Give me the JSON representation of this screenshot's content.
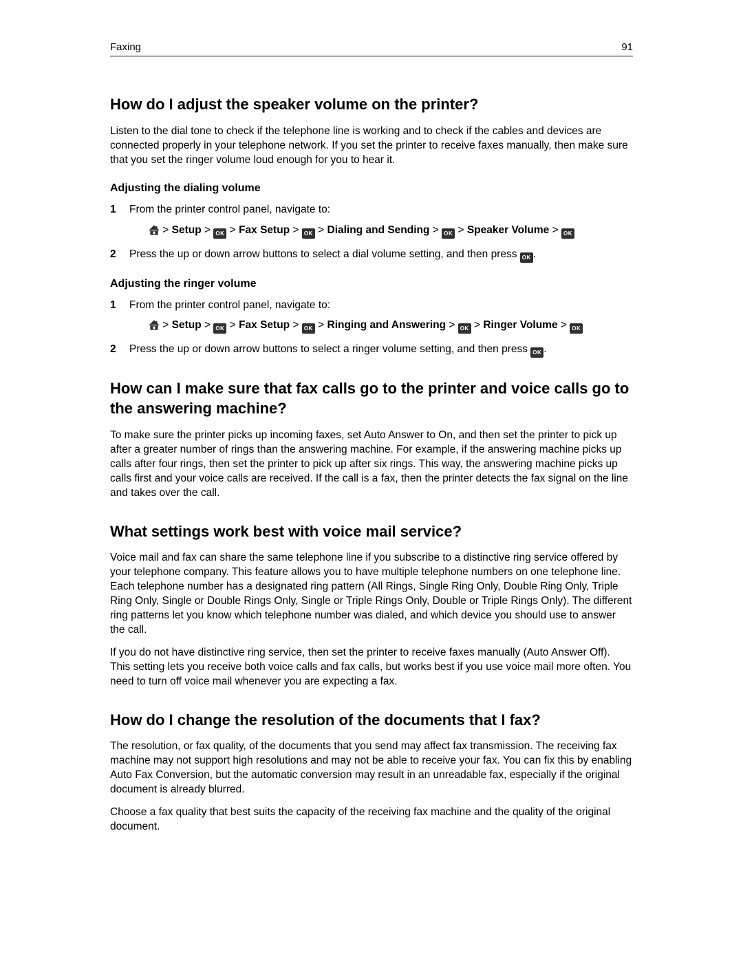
{
  "header": {
    "section": "Faxing",
    "page_number": "91"
  },
  "icons": {
    "ok_label": "OK"
  },
  "s1": {
    "title": "How do I adjust the speaker volume on the printer?",
    "intro": "Listen to the dial tone to check if the telephone line is working and to check if the cables and devices are connected properly in your telephone network. If you set the printer to receive faxes manually, then make sure that you set the ringer volume loud enough for you to hear it.",
    "sub_a_title": "Adjusting the dialing volume",
    "sub_a_step1": "From the printer control panel, navigate to:",
    "sub_a_nav": {
      "w1": "Setup",
      "w2": "Fax Setup",
      "w3": "Dialing and Sending",
      "w4": "Speaker Volume"
    },
    "sub_a_step2_a": "Press the up or down arrow buttons to select a dial volume setting, and then press ",
    "sub_a_step2_b": ".",
    "sub_b_title": "Adjusting the ringer volume",
    "sub_b_step1": "From the printer control panel, navigate to:",
    "sub_b_nav": {
      "w1": "Setup",
      "w2": "Fax Setup",
      "w3": "Ringing and Answering",
      "w4": "Ringer Volume"
    },
    "sub_b_step2_a": "Press the up or down arrow buttons to select a ringer volume setting, and then press ",
    "sub_b_step2_b": "."
  },
  "s2": {
    "title": "How can I make sure that fax calls go to the printer and voice calls go to the answering machine?",
    "body": "To make sure the printer picks up incoming faxes, set Auto Answer to On, and then set the printer to pick up after a greater number of rings than the answering machine. For example, if the answering machine picks up calls after four rings, then set the printer to pick up after six rings. This way, the answering machine picks up calls first and your voice calls are received. If the call is a fax, then the printer detects the fax signal on the line and takes over the call."
  },
  "s3": {
    "title": "What settings work best with voice mail service?",
    "p1": "Voice mail and fax can share the same telephone line if you subscribe to a distinctive ring service offered by your telephone company. This feature allows you to have multiple telephone numbers on one telephone line. Each telephone number has a designated ring pattern (All Rings, Single Ring Only, Double Ring Only, Triple Ring Only, Single or Double Rings Only, Single or Triple Rings Only, Double or Triple Rings Only). The different ring patterns let you know which telephone number was dialed, and which device you should use to answer the call.",
    "p2": "If you do not have distinctive ring service, then set the printer to receive faxes manually (Auto Answer Off). This setting lets you receive both voice calls and fax calls, but works best if you use voice mail more often. You need to turn off voice mail whenever you are expecting a fax."
  },
  "s4": {
    "title": "How do I change the resolution of the documents that I fax?",
    "p1": "The resolution, or fax quality, of the documents that you send may affect fax transmission. The receiving fax machine may not support high resolutions and may not be able to receive your fax. You can fix this by enabling Auto Fax Conversion, but the automatic conversion may result in an unreadable fax, especially if the original document is already blurred.",
    "p2": "Choose a fax quality that best suits the capacity of the receiving fax machine and the quality of the original document."
  }
}
